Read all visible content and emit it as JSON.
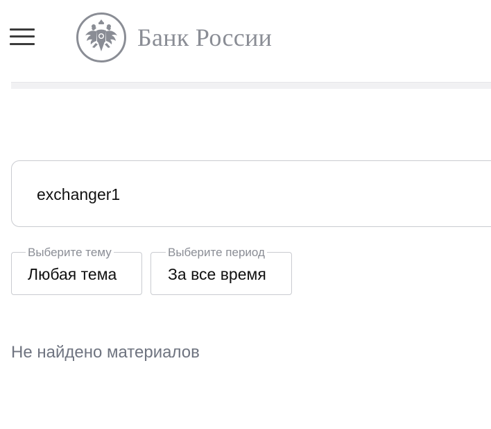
{
  "header": {
    "logo_text": "Банк России",
    "menu_icon": "hamburger-menu-icon",
    "emblem_icon": "double-headed-eagle-emblem-icon"
  },
  "search": {
    "value": "exchanger1",
    "placeholder": ""
  },
  "filters": {
    "topic": {
      "label": "Выберите тему",
      "value": "Любая тема"
    },
    "period": {
      "label": "Выберите период",
      "value": "За все время"
    }
  },
  "results": {
    "empty_message": "Не найдено материалов"
  },
  "colors": {
    "logo_gray": "#8a8d95",
    "border": "#c9cbd0",
    "muted_text": "#6f7480"
  }
}
